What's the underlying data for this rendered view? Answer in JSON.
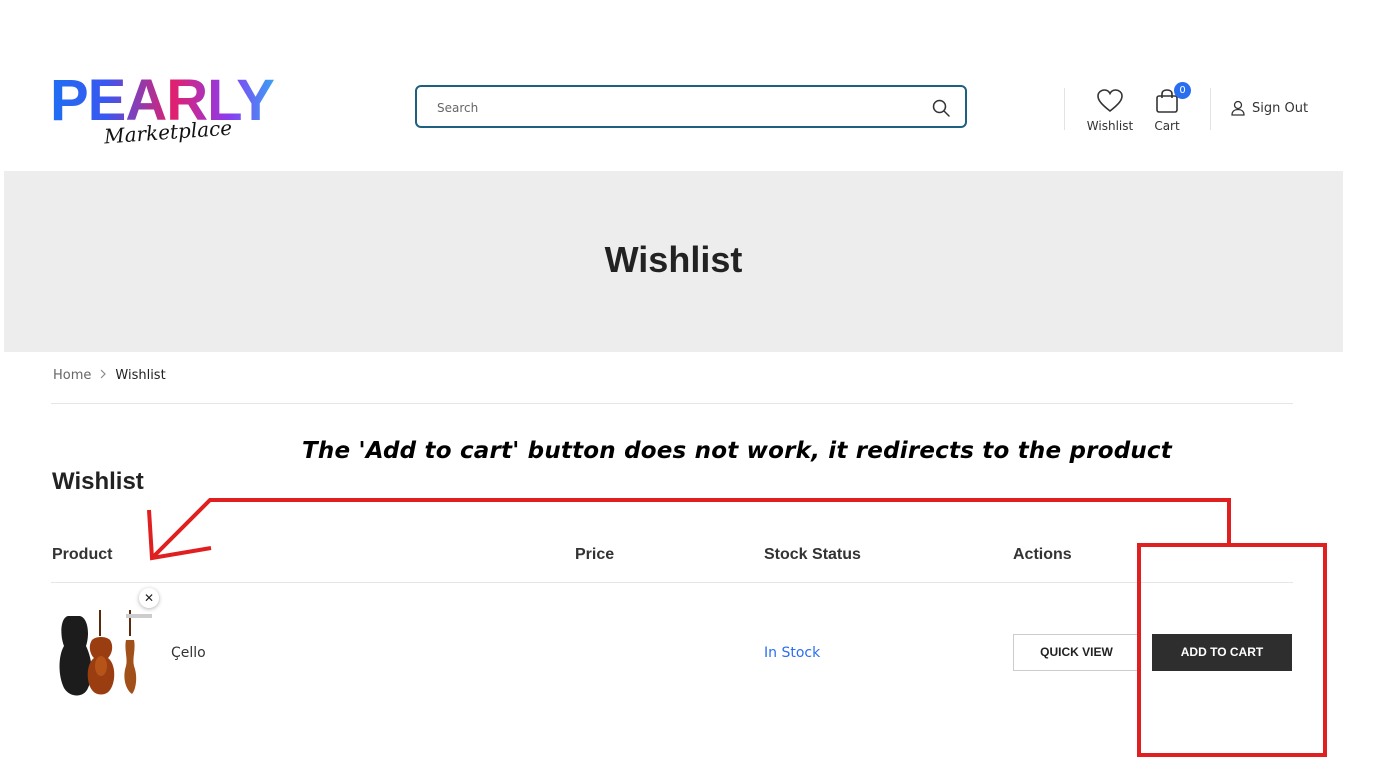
{
  "header": {
    "logo_main": "PEARLY",
    "logo_sub": "Marketplace",
    "search_placeholder": "Search",
    "wishlist_label": "Wishlist",
    "cart_label": "Cart",
    "cart_count": "0",
    "signout_label": "Sign Out"
  },
  "banner": {
    "title": "Wishlist"
  },
  "breadcrumb": {
    "home": "Home",
    "current": "Wishlist"
  },
  "annotation": "The 'Add to cart' button does not work, it redirects to the product",
  "wishlist": {
    "title": "Wishlist",
    "columns": [
      "Product",
      "Price",
      "Stock Status",
      "Actions"
    ],
    "rows": [
      {
        "product": "Çello",
        "price": "",
        "stock": "In Stock",
        "quick_view": "QUICK VIEW",
        "add_to_cart": "ADD TO CART"
      }
    ]
  },
  "colors": {
    "accent": "#2a6ef0",
    "search_border": "#1f5f80",
    "banner_bg": "#ededed",
    "annotation_red": "#e02020",
    "button_dark": "#2e2e2e"
  },
  "icons": [
    "search-icon",
    "heart-icon",
    "cart-icon",
    "user-icon",
    "chevron-right-icon",
    "close-icon",
    "cello-image"
  ]
}
